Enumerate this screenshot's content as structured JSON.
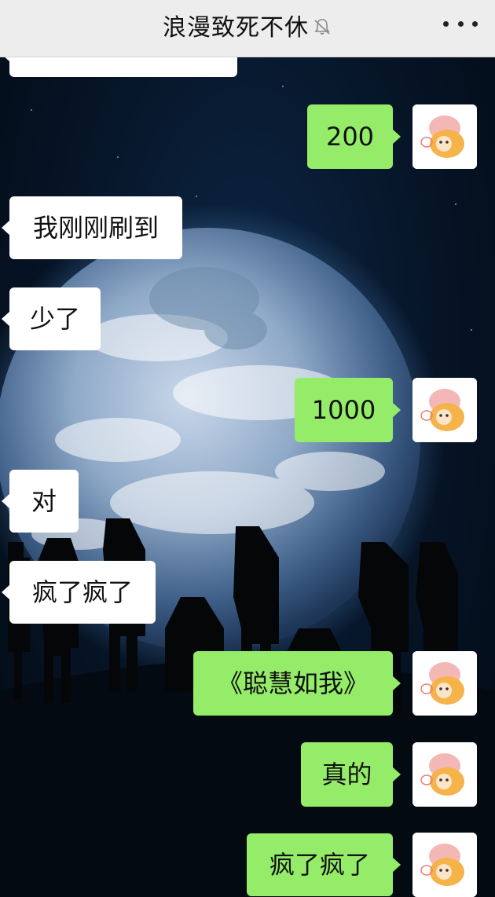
{
  "header": {
    "title": "浪漫致死不休",
    "mute_icon": "bell-off-icon",
    "more_icon": "more-dots-icon"
  },
  "colors": {
    "header_bg": "#ededed",
    "sent_bubble": "#95ec69",
    "received_bubble": "#ffffff"
  },
  "messages": [
    {
      "side": "left",
      "text": "",
      "partial": true
    },
    {
      "side": "right",
      "text": "200"
    },
    {
      "side": "left",
      "text": "我刚刚刷到"
    },
    {
      "side": "left",
      "text": "少了"
    },
    {
      "side": "right",
      "text": "1000"
    },
    {
      "side": "left",
      "text": "对"
    },
    {
      "side": "left",
      "text": "疯了疯了"
    },
    {
      "side": "right",
      "text": "《聪慧如我》"
    },
    {
      "side": "right",
      "text": "真的"
    },
    {
      "side": "right",
      "text": "疯了疯了"
    }
  ],
  "avatar_icon": "cartoon-avatar-icon"
}
